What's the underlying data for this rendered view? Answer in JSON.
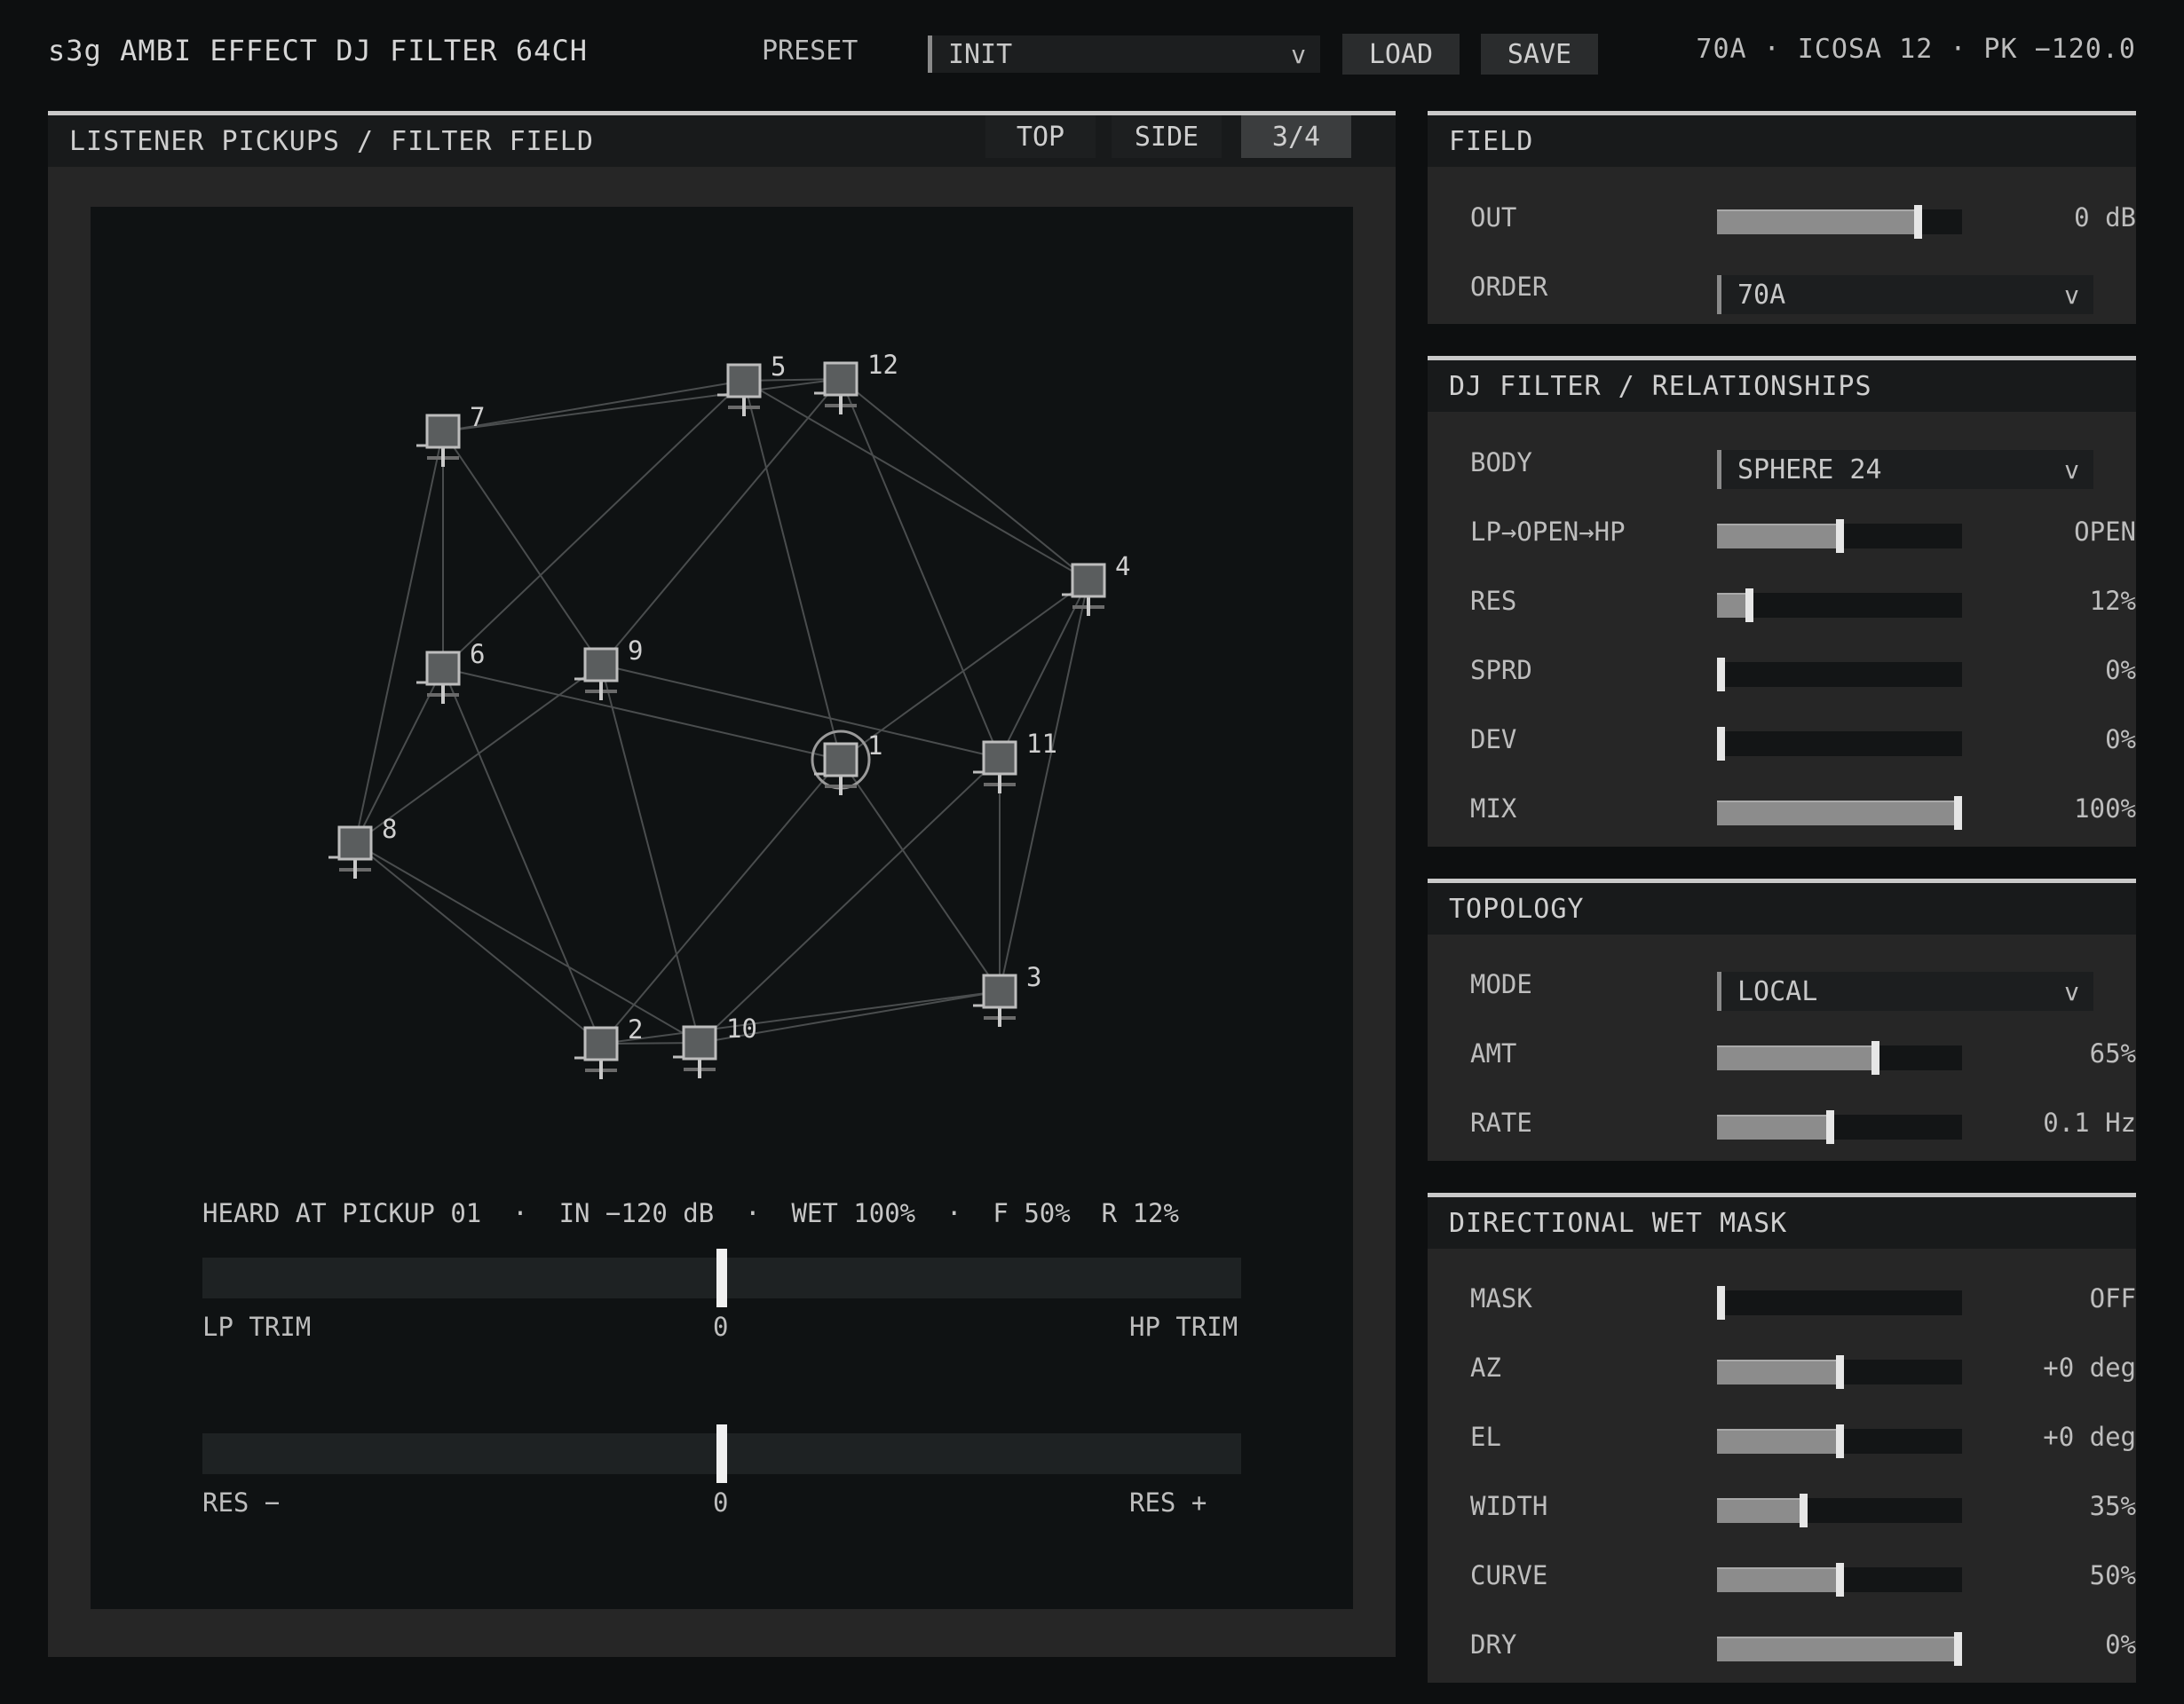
{
  "header": {
    "title": "s3g AMBI EFFECT DJ FILTER 64CH",
    "preset_label": "PRESET",
    "preset_value": "INIT",
    "load_label": "LOAD",
    "save_label": "SAVE",
    "status": "70A · ICOSA 12 · PK −120.0"
  },
  "field_panel": {
    "title": "LISTENER PICKUPS / FILTER FIELD",
    "tabs": [
      {
        "label": "TOP",
        "active": false
      },
      {
        "label": "SIDE",
        "active": false
      },
      {
        "label": "3/4",
        "active": true
      }
    ],
    "nodes": [
      {
        "id": "1",
        "selected": true
      },
      {
        "id": "2"
      },
      {
        "id": "3"
      },
      {
        "id": "4"
      },
      {
        "id": "5"
      },
      {
        "id": "6"
      },
      {
        "id": "7"
      },
      {
        "id": "8"
      },
      {
        "id": "9"
      },
      {
        "id": "10"
      },
      {
        "id": "11"
      },
      {
        "id": "12"
      }
    ],
    "heard_line": "HEARD AT PICKUP 01  ·  IN −120 dB  ·  WET 100%  ·  F 50%  R 12%",
    "trim": {
      "left_label": "LP TRIM",
      "center_label": "0",
      "right_label": "HP TRIM",
      "value": 0.5
    },
    "res": {
      "left_label": "RES −",
      "center_label": "0",
      "right_label": "RES +",
      "value": 0.5
    }
  },
  "sections": {
    "field": {
      "title": "FIELD",
      "out": {
        "label": "OUT",
        "value": "0 dB",
        "level": 0.83
      },
      "order": {
        "label": "ORDER",
        "value": "70A"
      }
    },
    "dj_filter": {
      "title": "DJ FILTER / RELATIONSHIPS",
      "body": {
        "label": "BODY",
        "value": "SPHERE 24"
      },
      "lp_open_hp": {
        "label": "LP→OPEN→HP",
        "value": "OPEN",
        "level": 0.5
      },
      "res": {
        "label": "RES",
        "value": "12%",
        "level": 0.12
      },
      "sprd": {
        "label": "SPRD",
        "value": "0%",
        "level": 0
      },
      "dev": {
        "label": "DEV",
        "value": "0%",
        "level": 0
      },
      "mix": {
        "label": "MIX",
        "value": "100%",
        "level": 1
      }
    },
    "topology": {
      "title": "TOPOLOGY",
      "mode": {
        "label": "MODE",
        "value": "LOCAL"
      },
      "amt": {
        "label": "AMT",
        "value": "65%",
        "level": 0.65
      },
      "rate": {
        "label": "RATE",
        "value": "0.1 Hz",
        "level": 0.46
      }
    },
    "mask": {
      "title": "DIRECTIONAL WET MASK",
      "mask": {
        "label": "MASK",
        "value": "OFF",
        "level": 0
      },
      "az": {
        "label": "AZ",
        "value": "+0 deg",
        "level": 0.5
      },
      "el": {
        "label": "EL",
        "value": "+0 deg",
        "level": 0.5
      },
      "width": {
        "label": "WIDTH",
        "value": "35%",
        "level": 0.35
      },
      "curve": {
        "label": "CURVE",
        "value": "50%",
        "level": 0.5
      },
      "dry": {
        "label": "DRY",
        "value": "0%",
        "level": 1
      }
    }
  }
}
